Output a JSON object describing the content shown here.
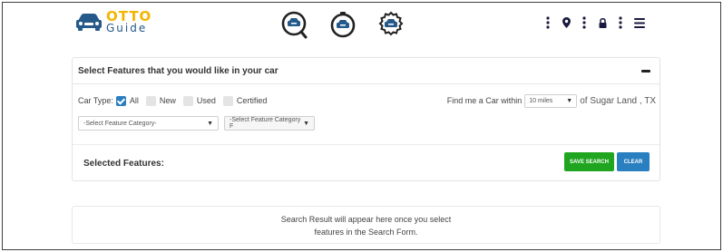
{
  "header": {
    "logo_otto": "OTTO",
    "logo_guide": "Guide"
  },
  "icons": {
    "center": [
      "car-search-icon",
      "car-timer-icon",
      "car-settings-icon"
    ],
    "right": [
      "more-vert-icon",
      "location-pin-icon",
      "more-vert-icon",
      "lock-icon",
      "more-vert-icon",
      "menu-icon"
    ]
  },
  "features": {
    "title": "Select Features that you would like in your car",
    "car_type_label": "Car Type:",
    "car_types": [
      {
        "label": "All",
        "checked": true
      },
      {
        "label": "New",
        "checked": false
      },
      {
        "label": "Used",
        "checked": false
      },
      {
        "label": "Certified",
        "checked": false
      }
    ],
    "find_label": "Find me a Car within",
    "distance_value": "10 miles",
    "location": "of Sugar Land , TX",
    "category_select": "-Select Feature Category-",
    "feature_select": "-Select Feature Category F"
  },
  "selected": {
    "title": "Selected Features:",
    "save_label": "SAVE SEARCH",
    "clear_label": "CLEAR"
  },
  "results": {
    "line1": "Search Result will appear here once you select",
    "line2": "features in the Search Form."
  },
  "colors": {
    "brand_yellow": "#f5b400",
    "brand_blue": "#25598a",
    "save_green": "#1fa51f",
    "clear_blue": "#2a7fc0"
  }
}
